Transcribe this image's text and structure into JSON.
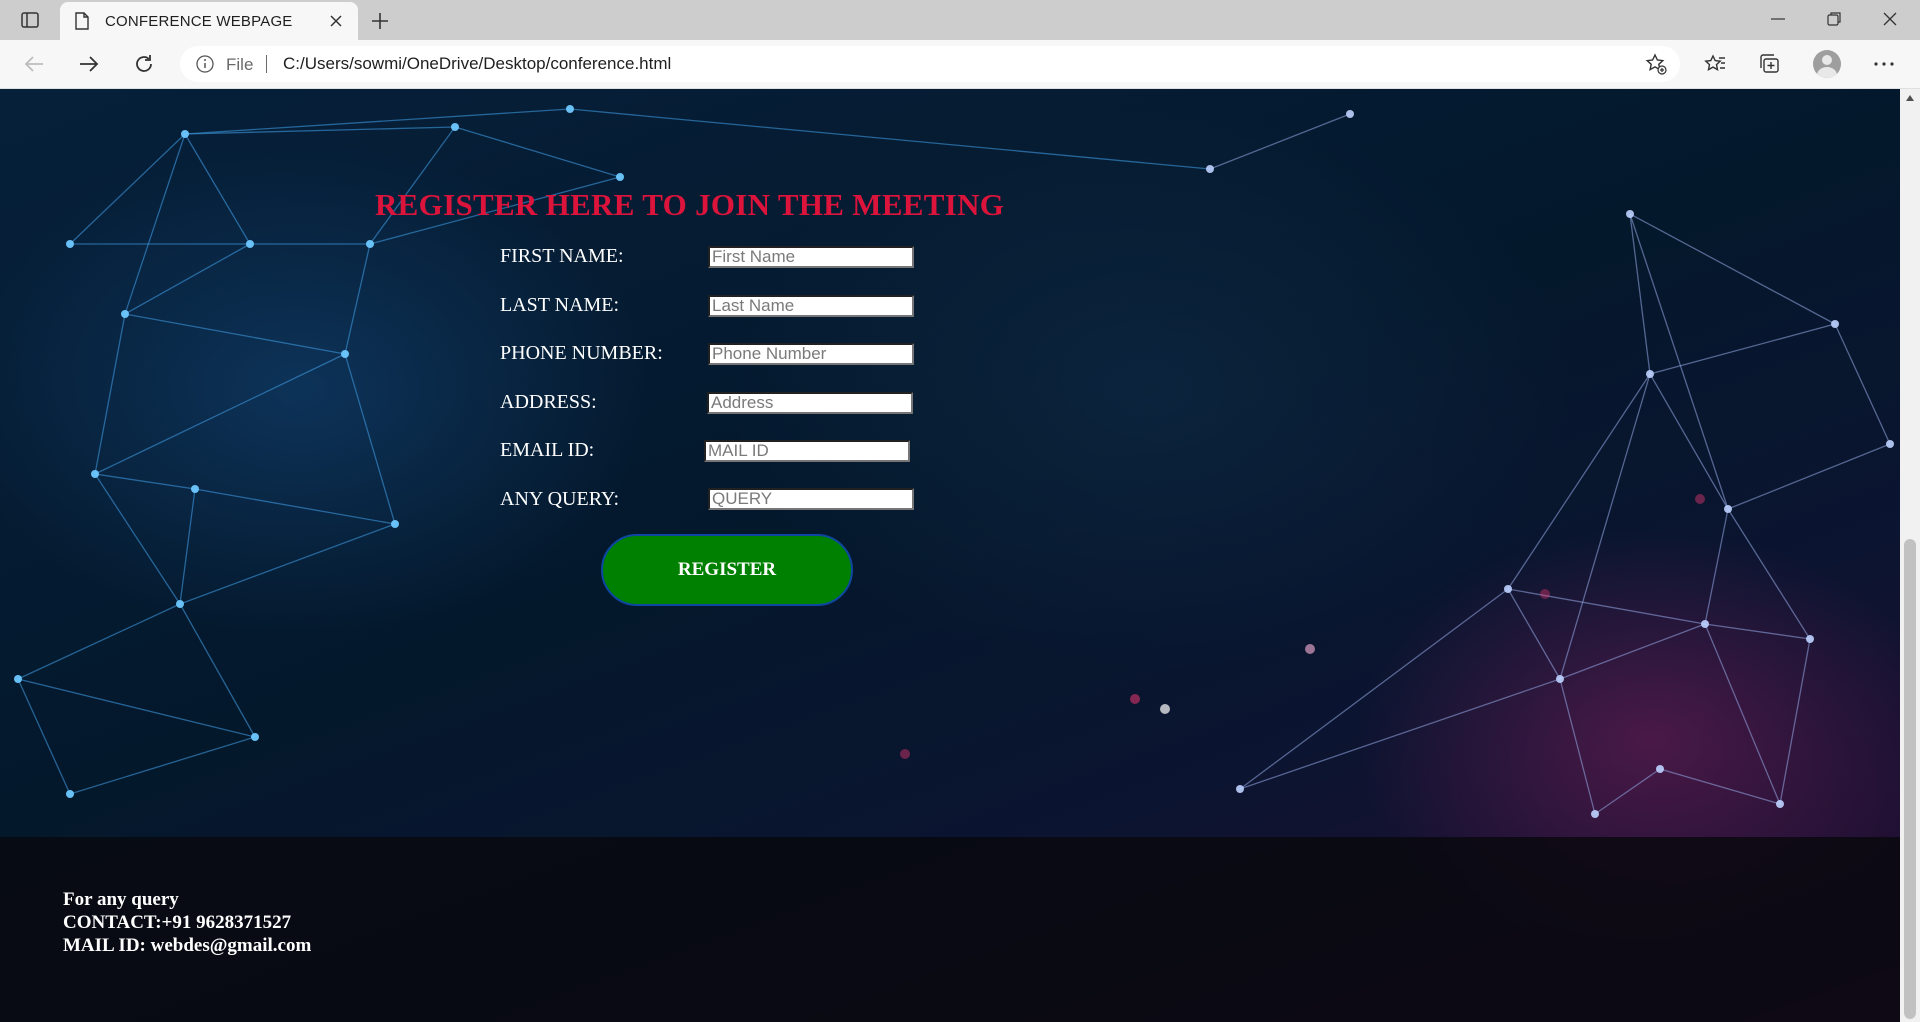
{
  "browser": {
    "tab_title": "CONFERENCE WEBPAGE",
    "address_scheme_label": "File",
    "url": "C:/Users/sowmi/OneDrive/Desktop/conference.html"
  },
  "page": {
    "heading": "REGISTER HERE TO JOIN THE MEETING",
    "fields": [
      {
        "label": "FIRST NAME:",
        "placeholder": "First Name"
      },
      {
        "label": "LAST NAME:",
        "placeholder": "Last Name"
      },
      {
        "label": "PHONE NUMBER:",
        "placeholder": "Phone Number"
      },
      {
        "label": "ADDRESS:",
        "placeholder": "Address"
      },
      {
        "label": "EMAIL ID:",
        "placeholder": "MAIL ID"
      },
      {
        "label": "ANY QUERY:",
        "placeholder": "QUERY"
      }
    ],
    "register_label": "REGISTER",
    "footer": {
      "line1": "For any query",
      "line2": "CONTACT:+91 9628371527",
      "line3": "MAIL ID: webdes@gmail.com"
    }
  },
  "colors": {
    "heading": "#dc143c",
    "register_button": "#008000",
    "register_border": "#0d47a1"
  },
  "icons": [
    "tab-actions-icon",
    "page-icon",
    "close-icon",
    "plus-icon",
    "minimize-icon",
    "restore-icon",
    "back-icon",
    "forward-icon",
    "refresh-icon",
    "info-icon",
    "favorite-add-icon",
    "favorites-icon",
    "collections-icon",
    "avatar",
    "more-icon"
  ]
}
